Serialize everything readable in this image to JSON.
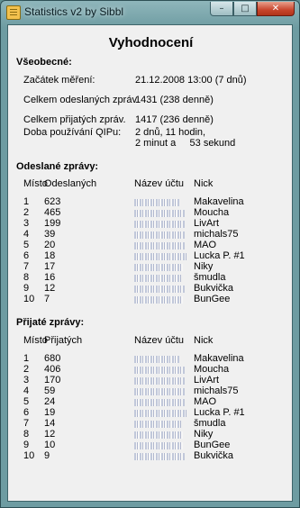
{
  "window": {
    "title": "Statistics v2 by Sibbl",
    "min_glyph": "–",
    "max_glyph": "□",
    "close_glyph": "✕"
  },
  "heading": "Vyhodnocení",
  "general": {
    "title": "Všeobecné:",
    "rows": [
      {
        "label": "Začátek měření:",
        "value": "21.12.2008 13:00 (7 dnů)"
      },
      {
        "label": "Celkem odeslaných zpráv",
        "value": "1431 (238 denně)"
      },
      {
        "label": "Celkem přijatých zpráv.",
        "value": "1417 (236 denně)"
      }
    ],
    "usage": {
      "label": "Doba používání QIPu:",
      "lines": [
        "2 dnů,   11 hodin,",
        "2 minut a     53 sekund"
      ]
    }
  },
  "sent": {
    "title": "Odeslané zprávy:",
    "headers": {
      "place": "Místo",
      "count": "Odeslaných",
      "account": "Název účtu",
      "nick": "Nick"
    },
    "rows": [
      {
        "place": "1",
        "count": "623",
        "nick": "Makavelina"
      },
      {
        "place": "2",
        "count": "465",
        "nick": "Moucha"
      },
      {
        "place": "3",
        "count": "199",
        "nick": "LivArt"
      },
      {
        "place": "4",
        "count": "39",
        "nick": "michals75"
      },
      {
        "place": "5",
        "count": "20",
        "nick": "MAO"
      },
      {
        "place": "6",
        "count": "18",
        "nick": "Lucka P. #1"
      },
      {
        "place": "7",
        "count": "17",
        "nick": "Niky"
      },
      {
        "place": "8",
        "count": "16",
        "nick": "šmudla"
      },
      {
        "place": "9",
        "count": "12",
        "nick": "Bukvička"
      },
      {
        "place": "10",
        "count": "7",
        "nick": "BunGee"
      }
    ]
  },
  "received": {
    "title": "Přijaté zprávy:",
    "headers": {
      "place": "Místo",
      "count": "Přijatých",
      "account": "Název účtu",
      "nick": "Nick"
    },
    "rows": [
      {
        "place": "1",
        "count": "680",
        "nick": "Makavelina"
      },
      {
        "place": "2",
        "count": "406",
        "nick": "Moucha"
      },
      {
        "place": "3",
        "count": "170",
        "nick": "LivArt"
      },
      {
        "place": "4",
        "count": "59",
        "nick": "michals75"
      },
      {
        "place": "5",
        "count": "24",
        "nick": "MAO"
      },
      {
        "place": "6",
        "count": "19",
        "nick": "Lucka P. #1"
      },
      {
        "place": "7",
        "count": "14",
        "nick": "šmudla"
      },
      {
        "place": "8",
        "count": "12",
        "nick": "Niky"
      },
      {
        "place": "9",
        "count": "10",
        "nick": "BunGee"
      },
      {
        "place": "10",
        "count": "9",
        "nick": "Bukvička"
      }
    ]
  }
}
